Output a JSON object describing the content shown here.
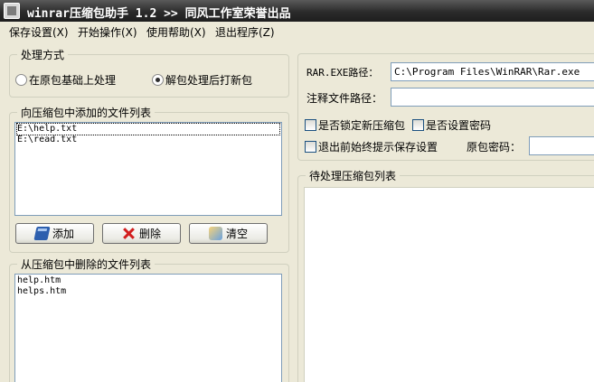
{
  "window": {
    "title": "winrar压缩包助手 1.2  >> 同风工作室荣誉出品"
  },
  "menu": [
    {
      "label": "保存设置(X)"
    },
    {
      "label": "开始操作(X)"
    },
    {
      "label": "使用帮助(X)"
    },
    {
      "label": "退出程序(Z)"
    }
  ],
  "process_mode": {
    "title": "处理方式",
    "options": [
      {
        "label": "在原包基础上处理",
        "selected": false
      },
      {
        "label": "解包处理后打新包",
        "selected": true
      }
    ]
  },
  "add_files": {
    "title": "向压缩包中添加的文件列表",
    "items": [
      "E:\\help.txt",
      "E:\\read.txt"
    ],
    "buttons": {
      "add": "添加",
      "delete": "删除",
      "clear": "清空"
    }
  },
  "remove_files": {
    "title": "从压缩包中删除的文件列表",
    "items": [
      "help.htm",
      "helps.htm"
    ]
  },
  "settings": {
    "rar_path_label": "RAR.EXE路径：",
    "rar_path_value": "C:\\Program Files\\WinRAR\\Rar.exe",
    "comment_path_label": "注释文件路径：",
    "comment_path_value": "",
    "lock_label": "是否锁定新压缩包",
    "password_label": "是否设置密码",
    "exit_prompt_label": "退出前始终提示保存设置",
    "orig_password_label": "原包密码：",
    "orig_password_value": ""
  },
  "pending": {
    "title": "待处理压缩包列表"
  }
}
